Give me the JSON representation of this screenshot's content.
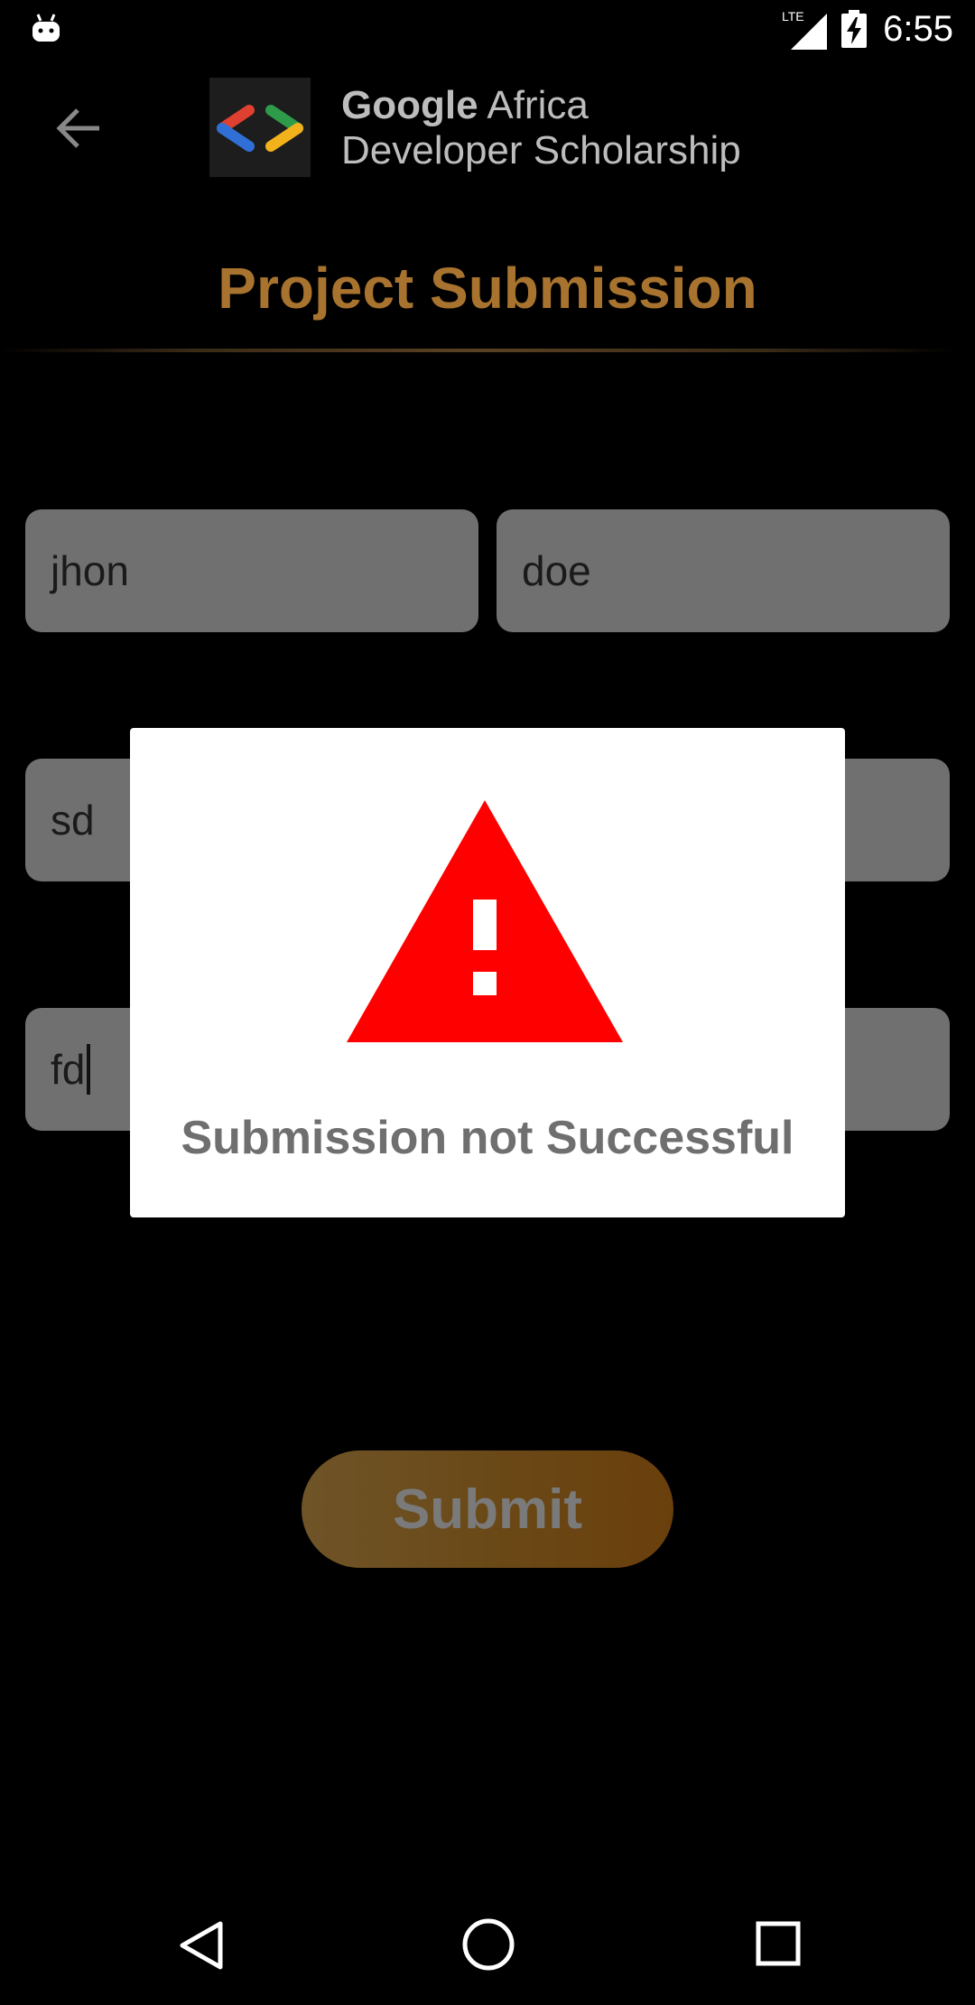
{
  "status_bar": {
    "time": "6:55",
    "network_label": "LTE",
    "icons": [
      "android-icon",
      "signal-lte-icon",
      "battery-charging-icon"
    ]
  },
  "header": {
    "back_icon": "arrow-back-icon",
    "logo_word1": "Google",
    "logo_word2": " Africa",
    "logo_line2": "Developer Scholarship"
  },
  "page": {
    "title": "Project Submission"
  },
  "form": {
    "first_name": "jhon",
    "last_name": "doe",
    "email": "sd",
    "github_link": "fd",
    "submit_label": "Submit"
  },
  "dialog": {
    "icon": "warning-icon",
    "message": "Submission not Successful"
  },
  "nav": {
    "icons": [
      "nav-back-icon",
      "nav-home-icon",
      "nav-recents-icon"
    ]
  },
  "colors": {
    "title": "#a8732e",
    "field_bg": "#707070",
    "warning": "#ff0000",
    "dialog_text": "#6f6f6f",
    "submit_gradient_start": "#6f5428",
    "submit_gradient_end": "#6a3f0c"
  }
}
